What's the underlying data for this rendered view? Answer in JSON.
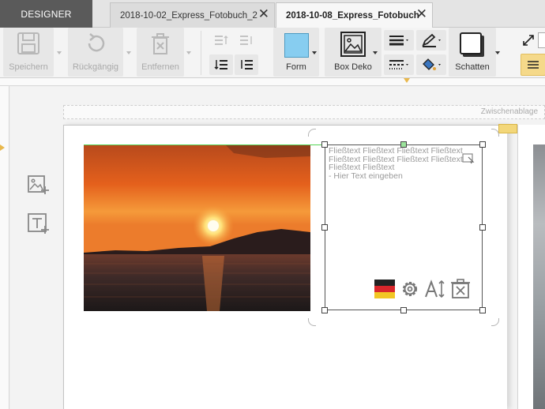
{
  "tabs": {
    "designer": "DESIGNER",
    "items": [
      {
        "label": "2018-10-02_Express_Fotobuch_2"
      },
      {
        "label": "2018-10-08_Express_Fotobuch"
      }
    ],
    "close_glyph": "✕"
  },
  "toolbar": {
    "save": "Speichern",
    "undo": "Rückgängig",
    "remove": "Entfernen",
    "shape": "Form",
    "box_deco": "Box Deko",
    "shadow": "Schatten",
    "shape_color": "#87cdf0",
    "active_align_color": "#f5d98a"
  },
  "workspace": {
    "clipboard": "Zwischenablage"
  },
  "textbox": {
    "lines": [
      "Fließtext Fließtext Fließtext Fließtext",
      "Fließtext Fließtext Fließtext Fließtext",
      "Fließtext Fließtext",
      "- Hier Text eingeben"
    ]
  },
  "icons": {
    "save": "floppy-icon",
    "undo": "undo-icon",
    "remove": "trash-icon",
    "shape": "shape-icon",
    "box_deco": "image-frame-icon",
    "shadow": "shadow-icon",
    "language": "german-flag-icon",
    "settings": "gear-icon",
    "font_size": "font-size-icon",
    "delete_box": "delete-box-icon",
    "add_image": "add-image-icon",
    "add_text": "add-text-icon"
  }
}
